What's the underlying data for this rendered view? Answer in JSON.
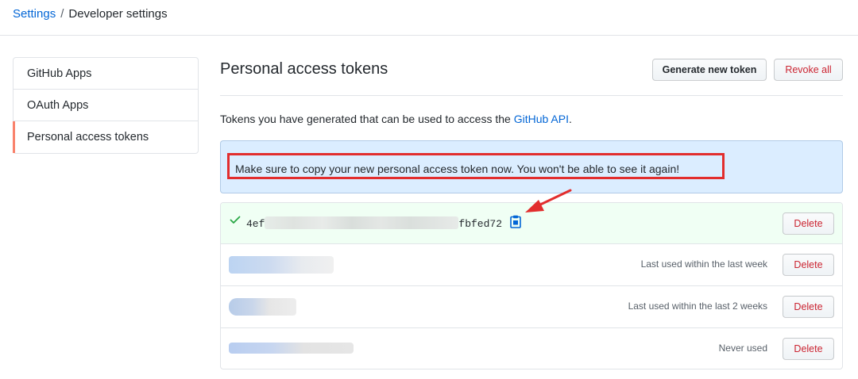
{
  "breadcrumb": {
    "root": "Settings",
    "separator": "/",
    "current": "Developer settings"
  },
  "sidebar": {
    "items": [
      {
        "label": "GitHub Apps",
        "selected": false
      },
      {
        "label": "OAuth Apps",
        "selected": false
      },
      {
        "label": "Personal access tokens",
        "selected": true
      }
    ]
  },
  "main": {
    "title": "Personal access tokens",
    "generate_label": "Generate new token",
    "revoke_label": "Revoke all",
    "description_prefix": "Tokens you have generated that can be used to access the ",
    "description_link": "GitHub API",
    "description_suffix": ".",
    "flash_message": "Make sure to copy your new personal access token now. You won't be able to see it again!"
  },
  "tokens": [
    {
      "value_start": "4ef",
      "value_end": "fbfed72",
      "last_used": "",
      "delete_label": "Delete",
      "is_new": true
    },
    {
      "last_used": "Last used within the last week",
      "delete_label": "Delete"
    },
    {
      "last_used": "Last used within the last 2 weeks",
      "delete_label": "Delete"
    },
    {
      "last_used": "Never used",
      "delete_label": "Delete"
    }
  ],
  "colors": {
    "link": "#0366d6",
    "danger": "#cb2431",
    "selected_indicator": "#f9826c",
    "flash_bg": "#dbedff",
    "new_token_bg": "#f0fff4",
    "annotation": "#e22d2d",
    "success": "#28a745"
  },
  "icons": {
    "check": "check-icon",
    "copy": "clipboard-icon"
  }
}
